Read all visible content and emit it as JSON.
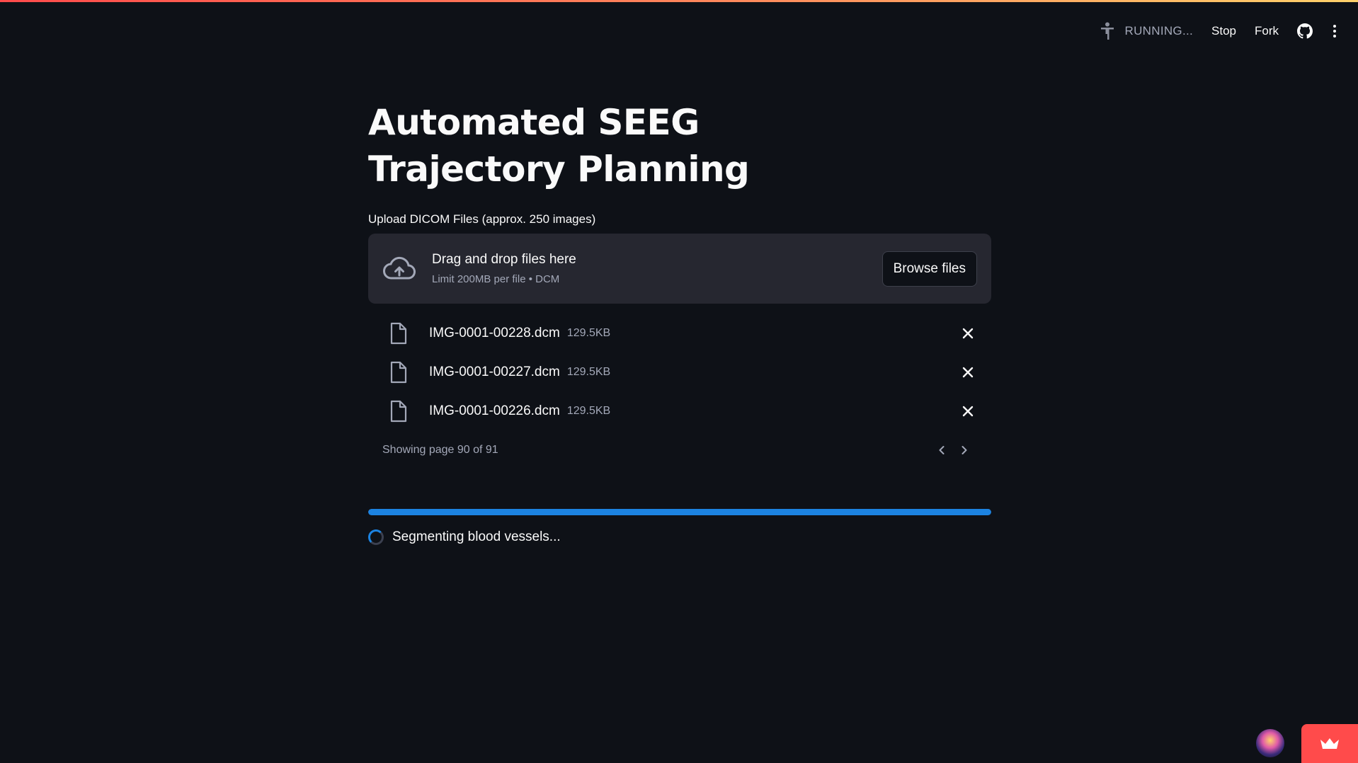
{
  "header": {
    "status_text": "RUNNING...",
    "stop_label": "Stop",
    "fork_label": "Fork",
    "icons": [
      "running-figure-icon",
      "github-icon",
      "more-vertical-icon"
    ]
  },
  "main": {
    "title": "Automated SEEG Trajectory Planning",
    "uploader": {
      "label": "Upload DICOM Files (approx. 250 images)",
      "drop_text": "Drag and drop files here",
      "limit_text": "Limit 200MB per file • DCM",
      "browse_label": "Browse files"
    },
    "files": [
      {
        "name": "IMG-0001-00228.dcm",
        "size": "129.5KB"
      },
      {
        "name": "IMG-0001-00227.dcm",
        "size": "129.5KB"
      },
      {
        "name": "IMG-0001-00226.dcm",
        "size": "129.5KB"
      }
    ],
    "pager_text": "Showing page 90 of 91",
    "progress": 1.0,
    "status_text": "Segmenting blood vessels..."
  },
  "colors": {
    "background": "#0e1117",
    "surface": "#262730",
    "accent_blue": "#1c83e1",
    "brand_red": "#ff4b4b"
  }
}
